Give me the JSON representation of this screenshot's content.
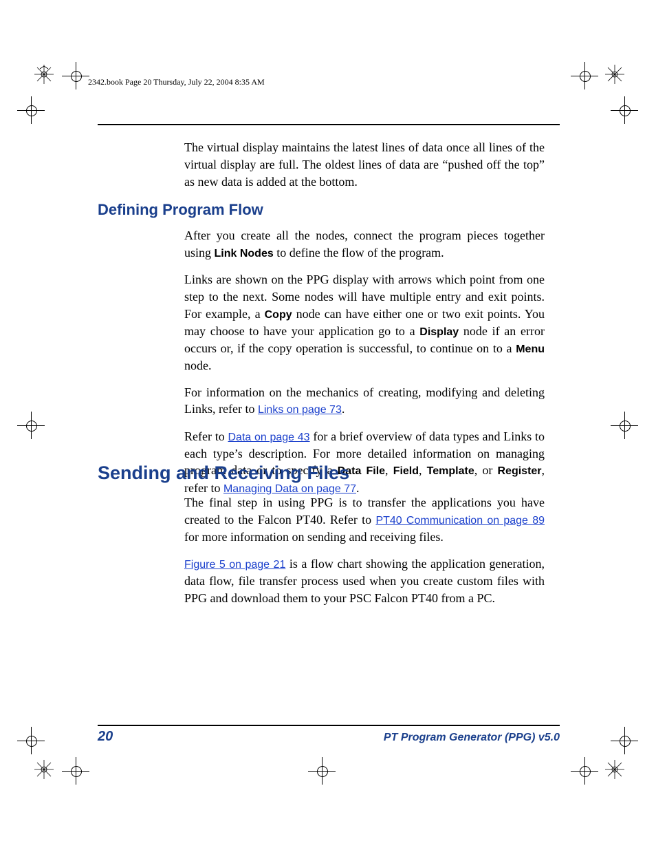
{
  "header": {
    "crop_text": "2342.book  Page 20  Thursday, July 22, 2004  8:35 AM"
  },
  "intro_para": "The virtual display maintains the latest lines of data once all lines of the virtual display are full. The oldest lines of data are “pushed off the top” as new data is added at the bottom.",
  "h2_flow": "Defining Program Flow",
  "flow": {
    "p1_a": "After you create all the nodes, connect the program pieces together using ",
    "p1_bold": "Link Nodes",
    "p1_b": " to define the flow of the program.",
    "p2_a": "Links are shown on the PPG display with arrows which point from one step to the next. Some nodes will have multiple entry and exit points. For example, a ",
    "p2_copy": "Copy",
    "p2_b": " node can have either one or two exit points. You may choose to have your application go to a ",
    "p2_display": "Display",
    "p2_c": " node if an error occurs or, if the copy operation is successful, to continue on to a ",
    "p2_menu": "Menu",
    "p2_d": " node.",
    "p3_a": "For information on the mechanics of creating, modifying and deleting Links, refer to ",
    "p3_link": "Links on page 73",
    "p3_b": ".",
    "p4_a": "Refer to ",
    "p4_link1": "Data on page 43",
    "p4_b": " for a brief overview of data types and Links to each type’s description. For more detailed information on managing program data or to specify a ",
    "p4_datafile": "Data File",
    "p4_c": ", ",
    "p4_field": "Field",
    "p4_d": ", ",
    "p4_template": "Template",
    "p4_e": ", or ",
    "p4_register": "Register",
    "p4_f": ", refer to ",
    "p4_link2": "Managing Data on page 77",
    "p4_g": "."
  },
  "h2_send": "Sending and Receiving Files",
  "send": {
    "p1_a": "The final step in using PPG is to transfer the applications you have created to the Falcon PT40. Refer to ",
    "p1_link": "PT40 Communication on page 89",
    "p1_b": " for more information on sending and receiving files.",
    "p2_link": "Figure 5 on page 21",
    "p2_a": " is a flow chart showing the application generation, data flow, file transfer process used when you create custom files with PPG and download them to your PSC Falcon PT40 from a PC."
  },
  "footer": {
    "page_number": "20",
    "title": "PT Program Generator (PPG)  v5.0"
  }
}
